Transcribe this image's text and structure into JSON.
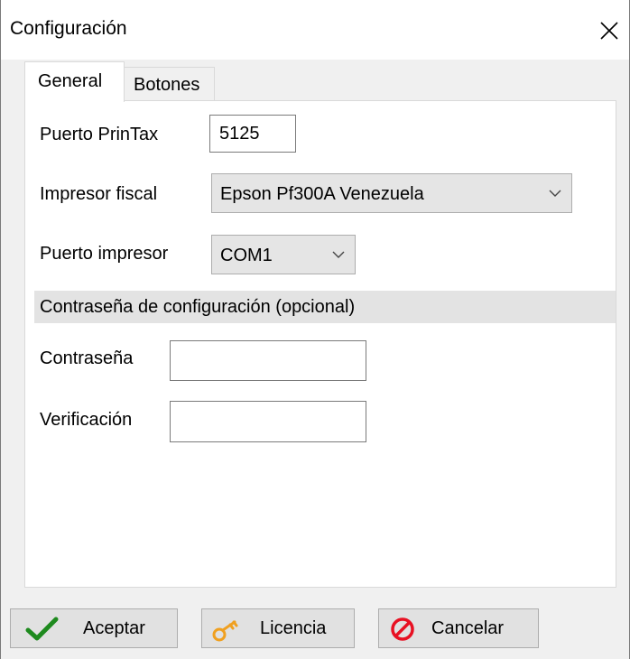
{
  "window": {
    "title": "Configuración",
    "close_glyph": "✕"
  },
  "tabs": [
    {
      "label": "General",
      "active": true
    },
    {
      "label": "Botones",
      "active": false
    }
  ],
  "general": {
    "port_label": "Puerto PrinTax",
    "port_value": "5125",
    "printer_label": "Impresor fiscal",
    "printer_value": "Epson Pf300A Venezuela",
    "printer_port_label": "Puerto impresor",
    "printer_port_value": "COM1",
    "password_section_title": "Contraseña de configuración (opcional)",
    "password_label": "Contraseña",
    "password_value": "",
    "verification_label": "Verificación",
    "verification_value": ""
  },
  "buttons": {
    "accept": {
      "label": "Aceptar",
      "icon": "checkmark-icon",
      "color": "#1e8a1e"
    },
    "license": {
      "label": "Licencia",
      "icon": "key-icon",
      "color": "#f0a020"
    },
    "cancel": {
      "label": "Cancelar",
      "icon": "cancel-icon",
      "color": "#e81123"
    }
  }
}
